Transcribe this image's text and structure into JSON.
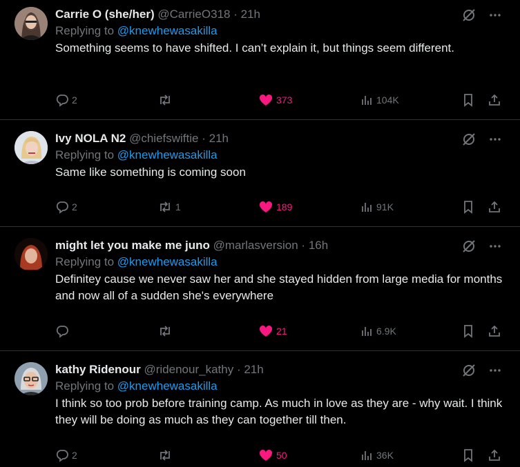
{
  "tweets": [
    {
      "name": "Carrie O (she/her)",
      "handle": "@CarrieO318",
      "dot": "·",
      "time": "21h",
      "reply_prefix": "Replying to",
      "reply_to": "@knewhewasakilla",
      "text": "Something seems to have shifted. I can’t explain it, but things seem different.",
      "replies": "2",
      "retweets": "",
      "likes": "373",
      "views": "104K"
    },
    {
      "name": "Ivy NOLA N2",
      "handle": "@chiefswiftie",
      "dot": "·",
      "time": "21h",
      "reply_prefix": "Replying to",
      "reply_to": "@knewhewasakilla",
      "text": "Same like something is coming soon",
      "replies": "2",
      "retweets": "1",
      "likes": "189",
      "views": "91K"
    },
    {
      "name": "might let you make me juno",
      "handle": "@marlasversion",
      "dot": "·",
      "time": "16h",
      "reply_prefix": "Replying to",
      "reply_to": "@knewhewasakilla",
      "text": "Definitey cause we never saw her and she stayed hidden from large media for months and now all of a sudden she's everywhere",
      "replies": "",
      "retweets": "",
      "likes": "21",
      "views": "6.9K"
    },
    {
      "name": "kathy Ridenour",
      "handle": "@ridenour_kathy",
      "dot": "·",
      "time": "21h",
      "reply_prefix": "Replying to",
      "reply_to": "@knewhewasakilla",
      "text": "I think so too prob before training camp. As much in love as they are - why wait. I think they will be doing as much as they can together till then.",
      "replies": "2",
      "retweets": "",
      "likes": "50",
      "views": "36K"
    }
  ],
  "icons": {
    "reply": "reply-icon",
    "retweet": "retweet-icon",
    "like": "heart-icon",
    "views": "views-icon",
    "bookmark": "bookmark-icon",
    "share": "share-icon",
    "grok": "grok-icon",
    "more": "more-icon"
  },
  "colors": {
    "background": "#000000",
    "text": "#e7e9ea",
    "secondary": "#71767b",
    "link": "#1d9bf0",
    "like": "#f91880",
    "divider": "#2f3336"
  }
}
